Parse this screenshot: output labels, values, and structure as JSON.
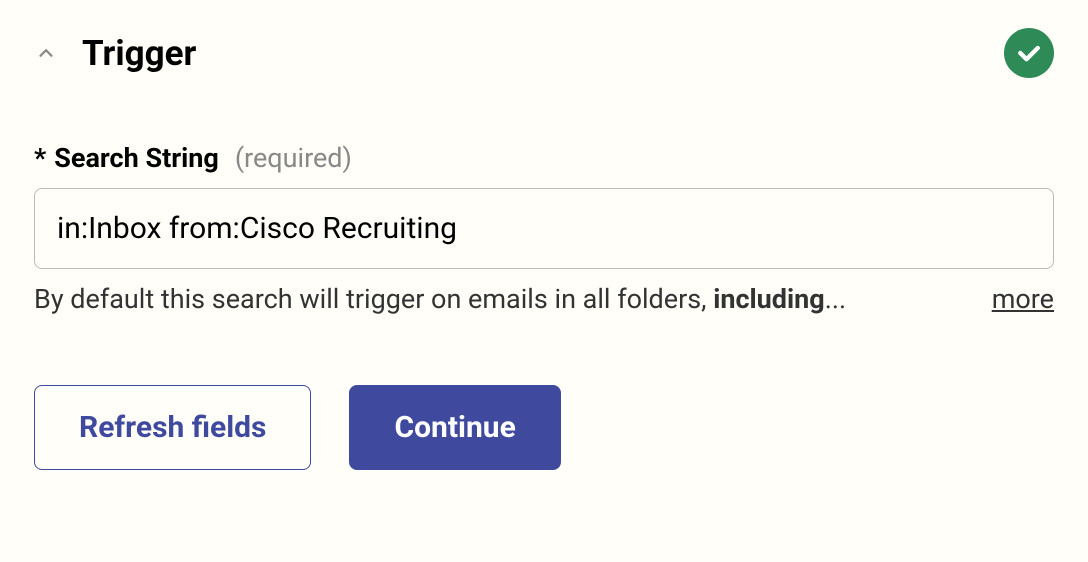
{
  "section": {
    "title": "Trigger"
  },
  "field": {
    "asterisk": "*",
    "label": "Search String",
    "required_text": "(required)",
    "value": "in:Inbox from:Cisco Recruiting",
    "helper_prefix": "By default this search will trigger on emails in all folders, ",
    "helper_bold": "including",
    "helper_suffix": "...",
    "more_label": "more"
  },
  "buttons": {
    "refresh_label": "Refresh fields",
    "continue_label": "Continue"
  }
}
